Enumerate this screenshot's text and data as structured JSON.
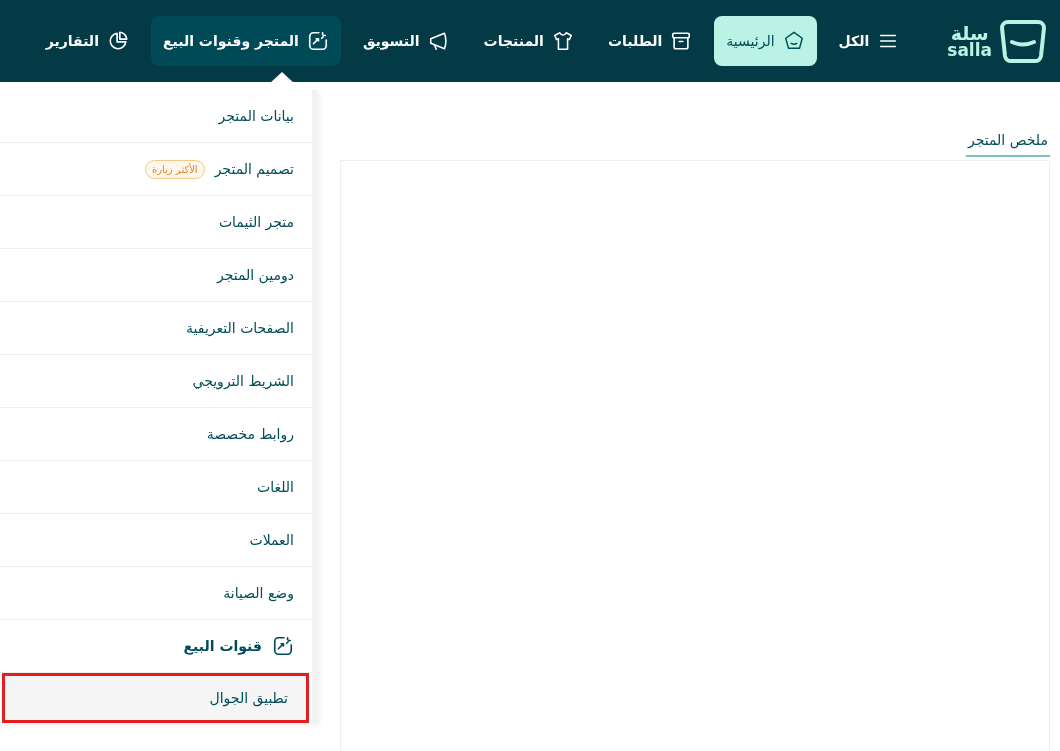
{
  "logo": {
    "arabic": "سلة",
    "latin": "salla"
  },
  "nav": [
    {
      "label": "الكل",
      "selected": false,
      "open": false
    },
    {
      "label": "الرئيسية",
      "selected": true,
      "open": false
    },
    {
      "label": "الطلبات",
      "selected": false,
      "open": false
    },
    {
      "label": "المنتجات",
      "selected": false,
      "open": false
    },
    {
      "label": "التسويق",
      "selected": false,
      "open": false
    },
    {
      "label": "المتجر وقنوات البيع",
      "selected": false,
      "open": true
    },
    {
      "label": "التقارير",
      "selected": false,
      "open": false
    }
  ],
  "dropdown": {
    "items": [
      {
        "kind": "item",
        "label": "بيانات المتجر",
        "highlighted": false
      },
      {
        "kind": "item",
        "label": "تصميم المتجر",
        "badge": "الأكثر زيارة",
        "highlighted": false
      },
      {
        "kind": "item",
        "label": "متجر الثيمات",
        "highlighted": false
      },
      {
        "kind": "item",
        "label": "دومين المتجر",
        "highlighted": false
      },
      {
        "kind": "item",
        "label": "الصفحات التعريفية",
        "highlighted": false
      },
      {
        "kind": "item",
        "label": "الشريط الترويجي",
        "highlighted": false
      },
      {
        "kind": "item",
        "label": "روابط مخصصة",
        "highlighted": false
      },
      {
        "kind": "item",
        "label": "اللغات",
        "highlighted": false
      },
      {
        "kind": "item",
        "label": "العملات",
        "highlighted": false
      },
      {
        "kind": "item",
        "label": "وضع الصيانة",
        "highlighted": false
      },
      {
        "kind": "header",
        "label": "قنوات البيع"
      },
      {
        "kind": "item",
        "label": "تطبيق الجوال",
        "highlighted": true
      }
    ]
  },
  "tabs": [
    {
      "label": "ملخص المتجر",
      "selected": true
    }
  ]
}
